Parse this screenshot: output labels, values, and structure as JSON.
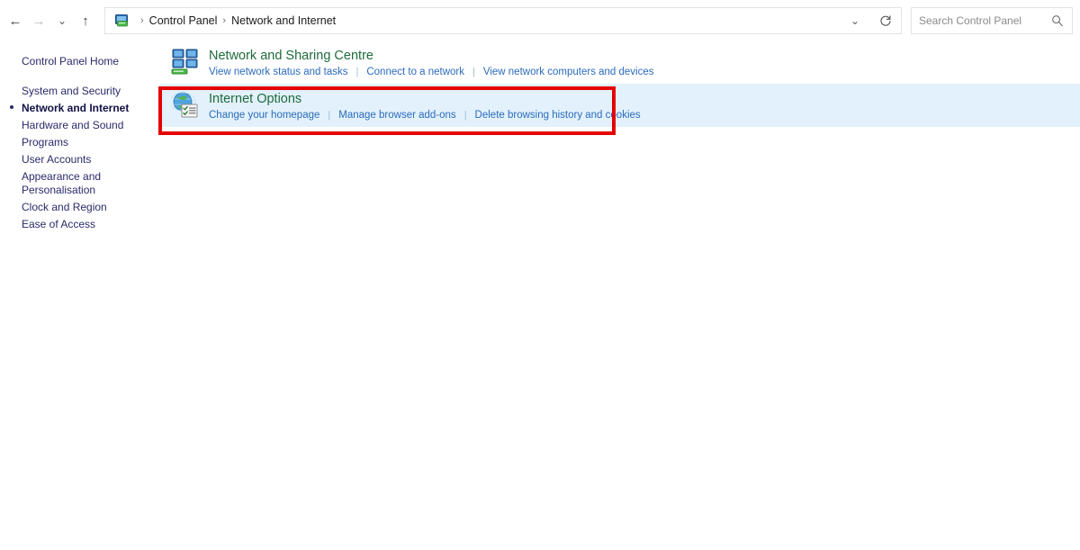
{
  "window": {
    "title": "Network and Internet"
  },
  "toolbar": {
    "back_icon": "back-arrow-icon",
    "back_glyph": "←",
    "forward_icon": "forward-arrow-icon",
    "forward_glyph": "→",
    "recent_icon": "chevron-down-icon",
    "recent_glyph": "⌄",
    "up_icon": "up-arrow-icon",
    "up_glyph": "↑",
    "dropdown_glyph": "⌄",
    "refresh_glyph": "↻"
  },
  "breadcrumb": {
    "icon": "control-panel-icon",
    "separator": "›",
    "items": [
      {
        "label": "Control Panel"
      },
      {
        "label": "Network and Internet"
      }
    ]
  },
  "search": {
    "placeholder": "Search Control Panel",
    "value": "",
    "icon": "search-icon"
  },
  "sidebar": {
    "home": {
      "label": "Control Panel Home"
    },
    "items": [
      {
        "label": "System and Security",
        "selected": false
      },
      {
        "label": "Network and Internet",
        "selected": true
      },
      {
        "label": "Hardware and Sound",
        "selected": false
      },
      {
        "label": "Programs",
        "selected": false
      },
      {
        "label": "User Accounts",
        "selected": false
      },
      {
        "label": "Appearance and Personalisation",
        "selected": false
      },
      {
        "label": "Clock and Region",
        "selected": false
      },
      {
        "label": "Ease of Access",
        "selected": false
      }
    ]
  },
  "main": {
    "categories": [
      {
        "title": "Network and Sharing Centre",
        "icon": "network-sharing-centre-icon",
        "highlighted": false,
        "links": [
          {
            "label": "View network status and tasks"
          },
          {
            "label": "Connect to a network"
          },
          {
            "label": "View network computers and devices"
          }
        ]
      },
      {
        "title": "Internet Options",
        "icon": "internet-options-icon",
        "highlighted": true,
        "links": [
          {
            "label": "Change your homepage"
          },
          {
            "label": "Manage browser add-ons"
          },
          {
            "label": "Delete browsing history and cookies"
          }
        ]
      }
    ]
  },
  "annotation": {
    "name": "internet-options-highlight-box",
    "color": "#e40000"
  },
  "colors": {
    "heading_green": "#1e6b3c",
    "link_blue": "#2b6bbd",
    "sidebar_navy": "#2a2a6b",
    "highlight_row": "#e2f1fc",
    "annotation_red": "#e40000"
  }
}
